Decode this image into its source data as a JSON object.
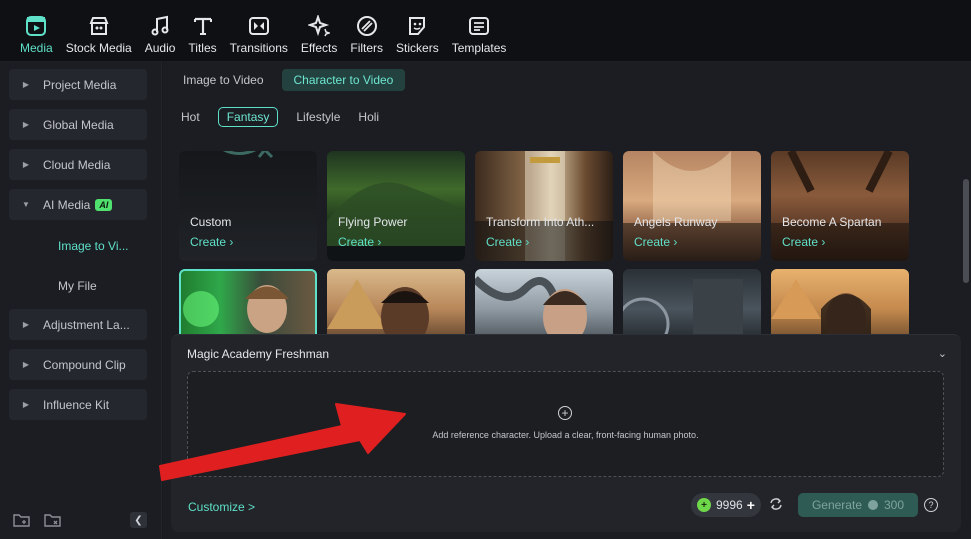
{
  "toolbar": {
    "items": [
      {
        "label": "Media",
        "icon": "media-icon"
      },
      {
        "label": "Stock Media",
        "icon": "store-icon"
      },
      {
        "label": "Audio",
        "icon": "music-note-icon"
      },
      {
        "label": "Titles",
        "icon": "text-icon"
      },
      {
        "label": "Transitions",
        "icon": "transition-icon"
      },
      {
        "label": "Effects",
        "icon": "sparkle-icon"
      },
      {
        "label": "Filters",
        "icon": "filter-icon"
      },
      {
        "label": "Stickers",
        "icon": "sticker-icon"
      },
      {
        "label": "Templates",
        "icon": "template-icon"
      }
    ],
    "active": "Media"
  },
  "sidebar": {
    "items": [
      {
        "label": "Project Media"
      },
      {
        "label": "Global Media"
      },
      {
        "label": "Cloud Media"
      },
      {
        "label": "AI Media",
        "badge": "AI"
      },
      {
        "label": "Adjustment La..."
      },
      {
        "label": "Compound Clip"
      },
      {
        "label": "Influence Kit"
      }
    ],
    "sub_items": [
      {
        "label": "Image to Vi..."
      },
      {
        "label": "My File"
      }
    ]
  },
  "content": {
    "tabs": [
      {
        "label": "Image to Video"
      },
      {
        "label": "Character to Video"
      }
    ],
    "chips": [
      {
        "label": "Hot"
      },
      {
        "label": "Fantasy"
      },
      {
        "label": "Lifestyle"
      },
      {
        "label": "Holi"
      }
    ],
    "cards_row1": [
      {
        "title": "Custom",
        "create": "Create"
      },
      {
        "title": "Flying Power",
        "create": "Create"
      },
      {
        "title": "Transform Into Ath...",
        "create": "Create"
      },
      {
        "title": "Angels Runway",
        "create": "Create"
      },
      {
        "title": "Become A Spartan",
        "create": "Create"
      }
    ]
  },
  "panel": {
    "title": "Magic Academy Freshman",
    "hint": "Add reference character. Upload a clear, front-facing human photo.",
    "customize": "Customize >",
    "credits": "9996",
    "generate_label": "Generate",
    "generate_cost": "300"
  },
  "colors": {
    "accent": "#5fe0c8",
    "arrow": "#e02020"
  }
}
